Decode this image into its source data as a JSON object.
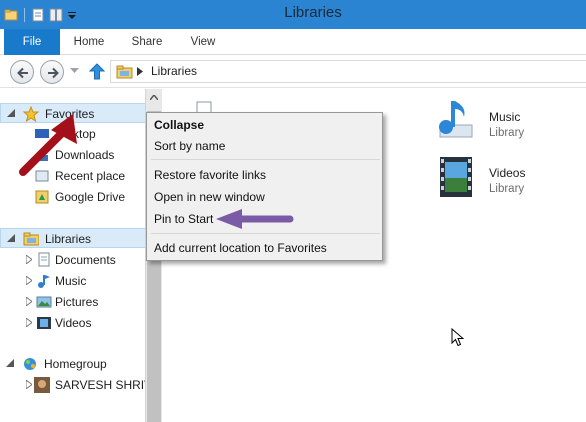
{
  "window": {
    "title": "Libraries"
  },
  "ribbon": {
    "tabs": [
      "File",
      "Home",
      "Share",
      "View"
    ]
  },
  "address": {
    "path": "Libraries"
  },
  "nav": {
    "favorites": {
      "label": "Favorites",
      "items": [
        "Desktop",
        "Downloads",
        "Recent places",
        "Google Drive"
      ],
      "visible_items": [
        "sktop",
        "Downloads",
        "Recent place",
        "Google Drive"
      ]
    },
    "libraries": {
      "label": "Libraries",
      "items": [
        "Documents",
        "Music",
        "Pictures",
        "Videos"
      ]
    },
    "homegroup": {
      "label": "Homegroup",
      "user": "SARVESH SHRIVA"
    }
  },
  "content": {
    "items": [
      {
        "name": "Music",
        "kind": "Library",
        "icon": "music-library-icon"
      },
      {
        "name": "Videos",
        "kind": "Library",
        "icon": "videos-library-icon"
      }
    ]
  },
  "context_menu": {
    "items": [
      "Collapse",
      "Sort by name",
      "Restore favorite links",
      "Open in new window",
      "Pin to Start",
      "Add current location to Favorites"
    ]
  },
  "colors": {
    "titlebar": "#2a84d2",
    "file_tab": "#1979ca",
    "annotation_red": "#b0101c",
    "annotation_purple": "#7b5aa6"
  }
}
